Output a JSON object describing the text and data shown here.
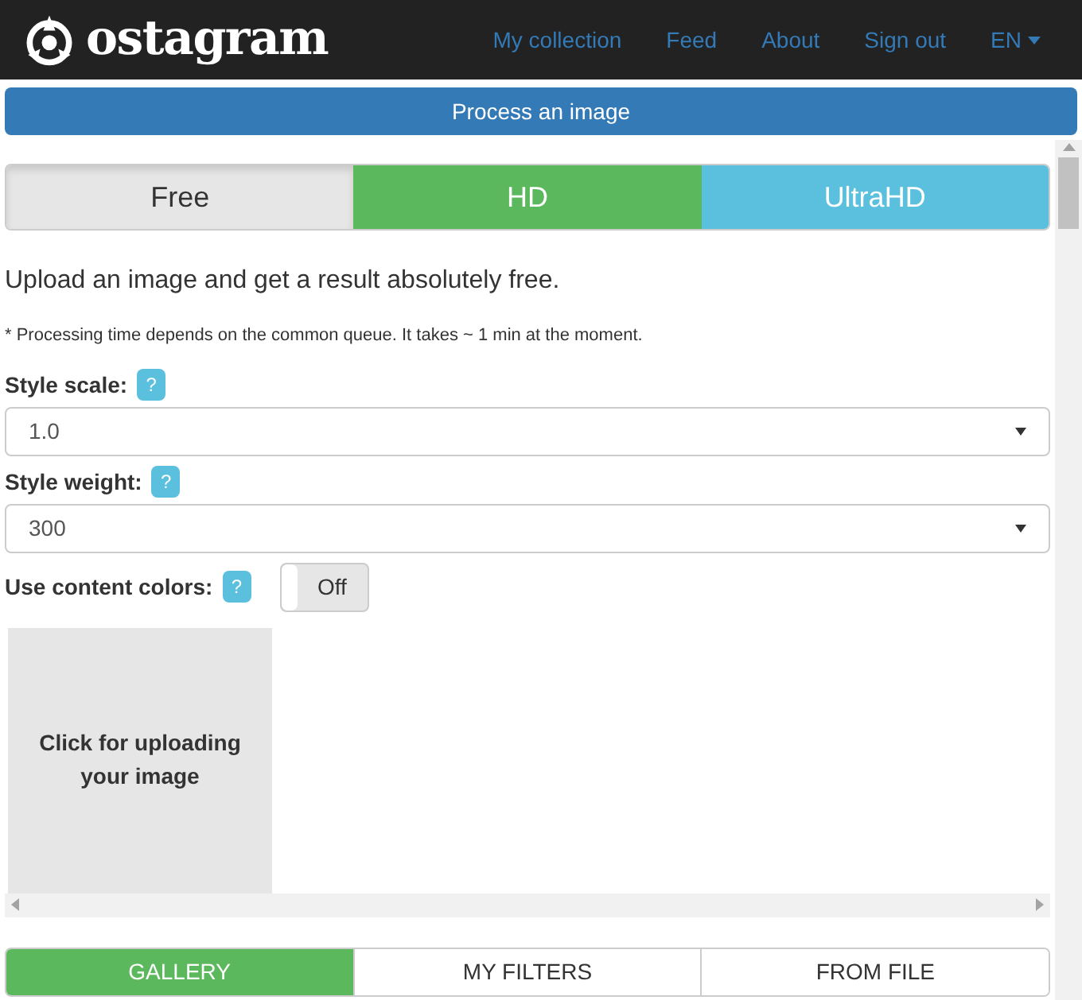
{
  "brand": "ostagram",
  "nav": [
    {
      "label": "My collection"
    },
    {
      "label": "Feed"
    },
    {
      "label": "About"
    },
    {
      "label": "Sign out"
    },
    {
      "label": "EN",
      "kind": "dropdown"
    }
  ],
  "process_button": "Process an image",
  "plans": [
    {
      "label": "Free",
      "selected": true,
      "color": "#e6e6e6"
    },
    {
      "label": "HD",
      "selected": false,
      "color": "#5cb85c"
    },
    {
      "label": "UltraHD",
      "selected": false,
      "color": "#5bc0de"
    }
  ],
  "intro": "Upload an image and get a result absolutely free.",
  "note": "* Processing time depends on the common queue. It takes ~ 1 min at the moment.",
  "fields": [
    {
      "label": "Style scale:",
      "help": "?",
      "kind": "select",
      "value": "1.0"
    },
    {
      "label": "Style weight:",
      "help": "?",
      "kind": "select",
      "value": "300"
    },
    {
      "label": "Use content colors:",
      "help": "?",
      "kind": "toggle",
      "on": false,
      "value": "Off"
    }
  ],
  "upload": "Click for uploading your image",
  "source_tabs": [
    {
      "label": "GALLERY",
      "selected": true
    },
    {
      "label": "MY FILTERS",
      "selected": false
    },
    {
      "label": "FROM FILE",
      "selected": false
    }
  ]
}
